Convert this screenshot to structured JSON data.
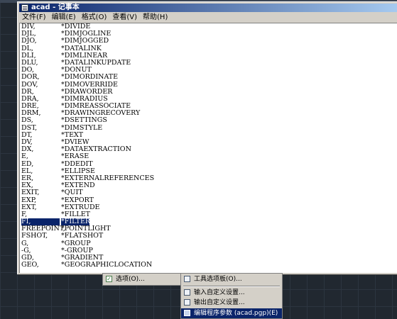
{
  "window": {
    "title": "acad - 记事本"
  },
  "menubar": [
    {
      "label": "文件(F)"
    },
    {
      "label": "编辑(E)"
    },
    {
      "label": "格式(O)"
    },
    {
      "label": "查看(V)"
    },
    {
      "label": "帮助(H)"
    }
  ],
  "lines": [
    {
      "alias": "DIV,",
      "command": "*DIVIDE"
    },
    {
      "alias": "DJL,",
      "command": "*DIMJOGLINE"
    },
    {
      "alias": "DJO,",
      "command": "*DIMJOGGED"
    },
    {
      "alias": "DL,",
      "command": "*DATALINK"
    },
    {
      "alias": "DLI,",
      "command": "*DIMLINEAR"
    },
    {
      "alias": "DLU,",
      "command": "*DATALINKUPDATE"
    },
    {
      "alias": "DO,",
      "command": "*DONUT"
    },
    {
      "alias": "DOR,",
      "command": "*DIMORDINATE"
    },
    {
      "alias": "DOV,",
      "command": "*DIMOVERRIDE"
    },
    {
      "alias": "DR,",
      "command": "*DRAWORDER"
    },
    {
      "alias": "DRA,",
      "command": "*DIMRADIUS"
    },
    {
      "alias": "DRE,",
      "command": "*DIMREASSOCIATE"
    },
    {
      "alias": "DRM,",
      "command": "*DRAWINGRECOVERY"
    },
    {
      "alias": "DS,",
      "command": "*DSETTINGS"
    },
    {
      "alias": "DST,",
      "command": "*DIMSTYLE"
    },
    {
      "alias": "DT,",
      "command": "*TEXT"
    },
    {
      "alias": "DV,",
      "command": "*DVIEW"
    },
    {
      "alias": "DX,",
      "command": "*DATAEXTRACTION"
    },
    {
      "alias": "E,",
      "command": "*ERASE"
    },
    {
      "alias": "ED,",
      "command": "*DDEDIT"
    },
    {
      "alias": "EL,",
      "command": "*ELLIPSE"
    },
    {
      "alias": "ER,",
      "command": "*EXTERNALREFERENCES"
    },
    {
      "alias": "EX,",
      "command": "*EXTEND"
    },
    {
      "alias": "EXIT,",
      "command": "*QUIT"
    },
    {
      "alias": "EXP,",
      "command": "*EXPORT"
    },
    {
      "alias": "EXT,",
      "command": "*EXTRUDE"
    },
    {
      "alias": "F,",
      "command": "*FILLET"
    },
    {
      "alias": "FI,",
      "command": "*FILTER",
      "selected": true
    },
    {
      "alias": "FREEPOINT,",
      "command": "*POINTLIGHT"
    },
    {
      "alias": "FSHOT,",
      "command": "*FLATSHOT"
    },
    {
      "alias": "G,",
      "command": "*GROUP"
    },
    {
      "alias": "-G,",
      "command": "*-GROUP"
    },
    {
      "alias": "GD,",
      "command": "*GRADIENT"
    },
    {
      "alias": "GEO,",
      "command": "*GEOGRAPHICLOCATION"
    }
  ],
  "context_menu_left": {
    "options_label": "选项(O)..."
  },
  "context_menu_right": {
    "tool_palettes_label": "工具选项板(O)...",
    "import_label": "输入自定义设置...",
    "export_label": "输出自定义设置...",
    "edit_pgp_label": "编辑程序参数 (acad.pgp)(E)"
  }
}
